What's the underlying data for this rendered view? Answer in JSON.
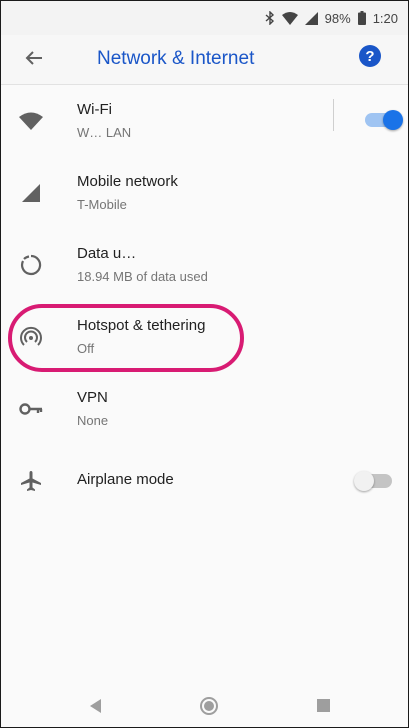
{
  "status_bar": {
    "battery_percent": "98%",
    "time": "1:20",
    "icons": [
      "bluetooth-icon",
      "wifi-signal-icon",
      "cell-signal-icon",
      "battery-icon"
    ]
  },
  "app_bar": {
    "title": "Network & Internet",
    "help_label": "?",
    "back_icon": "back-arrow-icon"
  },
  "items": [
    {
      "title": "Wi-Fi",
      "subtitle": "W… LAN",
      "icon": "wifi-icon",
      "toggle": "on"
    },
    {
      "title": "Mobile network",
      "subtitle": "T-Mobile",
      "icon": "cell-signal-icon"
    },
    {
      "title": "Data u…",
      "subtitle": "18.94 MB of data used",
      "icon": "data-usage-icon"
    },
    {
      "title": "Hotspot & tethering",
      "subtitle": "Off",
      "icon": "hotspot-icon"
    },
    {
      "title": "VPN",
      "subtitle": "None",
      "icon": "vpn-key-icon"
    },
    {
      "title": "Airplane mode",
      "subtitle": "",
      "icon": "airplane-icon",
      "toggle": "off"
    }
  ],
  "colors": {
    "accent": "#1a56c8",
    "toggle_on": "#1a73e8",
    "highlight": "#d81b73",
    "icon": "#616161",
    "subtitle": "#757575"
  },
  "nav_bar": {
    "icons": [
      "nav-back-icon",
      "nav-home-icon",
      "nav-recents-icon"
    ]
  }
}
